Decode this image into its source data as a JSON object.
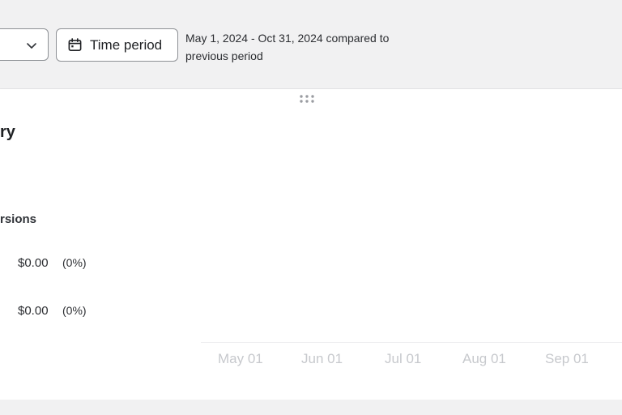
{
  "toolbar": {
    "time_period_label": "Time period",
    "period_line1": "May 1, 2024 - Oct 31, 2024 compared to",
    "period_line2": "previous period"
  },
  "card": {
    "title_partial": "ry",
    "section_label_partial": "rsions",
    "rows": [
      {
        "value": "$0.00",
        "change": "(0%)"
      },
      {
        "value": "$0.00",
        "change": "(0%)"
      }
    ]
  },
  "chart": {
    "x_ticks": [
      "May 01",
      "Jun 01",
      "Jul 01",
      "Aug 01",
      "Sep 01"
    ]
  },
  "icons": {
    "dropdown": "chevron-down-icon",
    "calendar": "calendar-icon",
    "drag": "drag-handle-icon"
  },
  "colors": {
    "page_bg": "#f1f1f2",
    "card_bg": "#ffffff",
    "border": "#8e9196",
    "tick_text": "#c7c9cd"
  }
}
